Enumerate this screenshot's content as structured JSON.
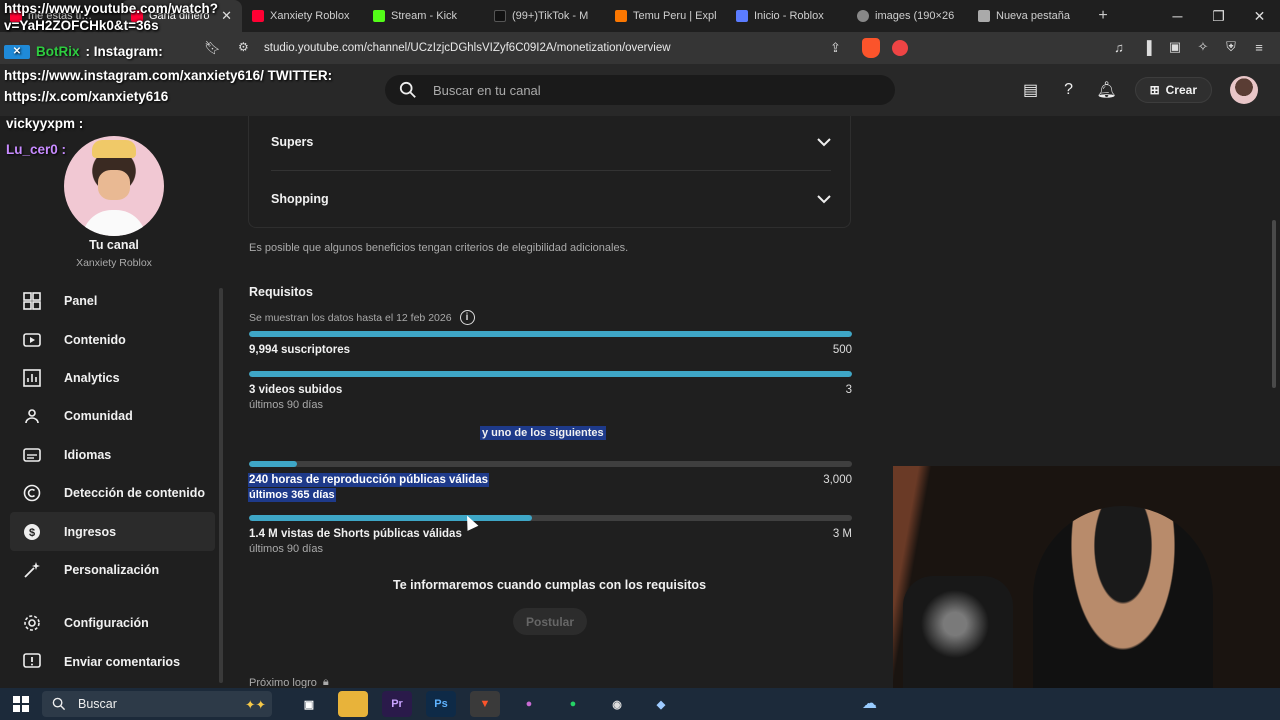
{
  "browser": {
    "tabs": [
      {
        "label": "me estas ti…",
        "active": false,
        "color": "#ff0033"
      },
      {
        "label": "Gana dinero",
        "active": true,
        "color": "#ff0033"
      },
      {
        "label": "Xanxiety Roblox",
        "active": false,
        "color": "#ff0033"
      },
      {
        "label": "Stream - Kick",
        "active": false,
        "color": "#53fc18"
      },
      {
        "label": "(99+)TikTok - M",
        "active": false,
        "color": "#111111"
      },
      {
        "label": "Temu Peru | Expl",
        "active": false,
        "color": "#fb7701"
      },
      {
        "label": "Inicio - Roblox",
        "active": false,
        "color": "#5b7cff"
      },
      {
        "label": "images (190×26",
        "active": false,
        "color": "#888888"
      },
      {
        "label": "Nueva pestaña",
        "active": false,
        "color": "#aaaaaa"
      }
    ],
    "url": "studio.youtube.com/channel/UCzIzjcDGhlsVIZyf6C09I2A/monetization/overview"
  },
  "header": {
    "search_placeholder": "Buscar en tu canal",
    "create_label": "Crear"
  },
  "sidebar": {
    "channel_title": "Tu canal",
    "channel_name": "Xanxiety Roblox",
    "items": [
      {
        "label": "Panel",
        "icon": "dashboard-icon",
        "active": false
      },
      {
        "label": "Contenido",
        "icon": "content-icon",
        "active": false
      },
      {
        "label": "Analytics",
        "icon": "analytics-icon",
        "active": false
      },
      {
        "label": "Comunidad",
        "icon": "community-icon",
        "active": false
      },
      {
        "label": "Idiomas",
        "icon": "subtitles-icon",
        "active": false
      },
      {
        "label": "Detección de contenido",
        "icon": "copyright-icon",
        "active": false
      },
      {
        "label": "Ingresos",
        "icon": "earn-icon",
        "active": true
      },
      {
        "label": "Personalización",
        "icon": "customization-icon",
        "active": false
      }
    ],
    "bottom_items": [
      {
        "label": "Configuración",
        "icon": "settings-icon"
      },
      {
        "label": "Enviar comentarios",
        "icon": "feedback-icon"
      }
    ]
  },
  "main": {
    "accordion": [
      "Supers",
      "Shopping"
    ],
    "note": "Es posible que algunos beneficios tengan criterios de elegibilidad adicionales.",
    "requirements_title": "Requisitos",
    "requirements_date": "Se muestran los datos hasta el 12 feb 2026",
    "requirements": [
      {
        "label": "9,994 suscriptores",
        "period": "",
        "target": "500",
        "progress": 1.0
      },
      {
        "label": "3 videos subidos",
        "period": "últimos 90 días",
        "target": "3",
        "progress": 1.0
      }
    ],
    "one_of": "y uno de los siguientes",
    "alternatives": [
      {
        "label": "240 horas de reproducción públicas válidas",
        "period": "últimos 365 días",
        "target": "3,000",
        "progress": 0.08
      },
      {
        "label": "1.4 M vistas de Shorts públicas válidas",
        "period": "últimos 90 días",
        "target": "3 M",
        "progress": 0.47
      }
    ],
    "inform": "Te informaremos cuando cumplas con los requisitos",
    "apply_label": "Postular",
    "next_goal": "Próximo logro"
  },
  "overlay": {
    "link_line1": "https://www.youtube.com/watch?",
    "link_line2": "v=YaH2ZOFCHk0&t=36s",
    "bot_name": "BotRix",
    "bot_text": ": Instagram:",
    "social_line1": "https://www.instagram.com/xanxiety616/ TWITTER:",
    "social_line2": "https://x.com/xanxiety616",
    "chat1": "vickyyxpm :",
    "chat2": "Lu_cer0 :"
  },
  "taskbar": {
    "search_label": "Buscar",
    "apps": [
      "Pr",
      "Ps"
    ]
  },
  "colors": {
    "accent": "#3ea6c6",
    "highlight": "#1e3a8a"
  }
}
